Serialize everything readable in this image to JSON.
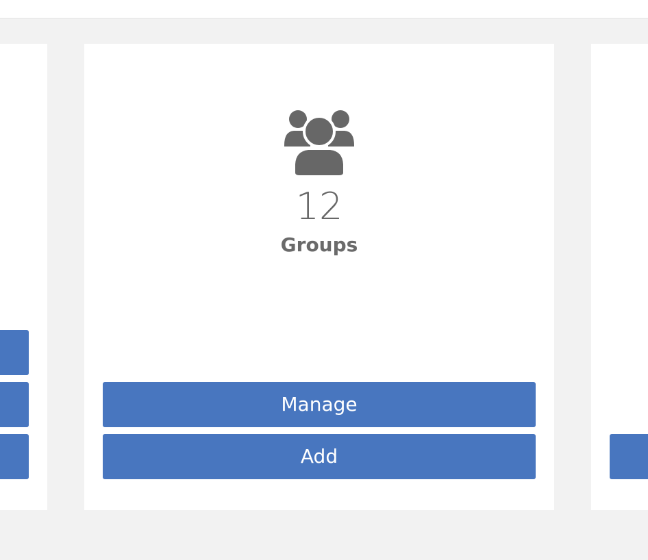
{
  "colors": {
    "background": "#f2f2f2",
    "card": "#ffffff",
    "button": "#4876bf",
    "text": "#676767"
  },
  "center_card": {
    "icon": "users-group-icon",
    "count": "12",
    "label": "Groups",
    "buttons": {
      "manage": "Manage",
      "add": "Add"
    }
  }
}
